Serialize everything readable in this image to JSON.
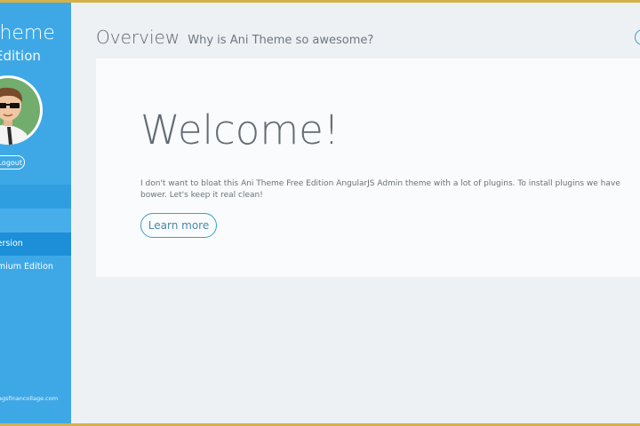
{
  "sidebar": {
    "title": "Theme",
    "subtitle": "Edition",
    "logout_label": "Logout",
    "nav_items": [
      {
        "label": ""
      },
      {
        "label": ""
      },
      {
        "label": "version"
      },
      {
        "label": "emium Edition"
      }
    ],
    "footer": "agsfinancollage.com"
  },
  "header": {
    "title": "Overview",
    "subtitle": "Why is Ani Theme so awesome?"
  },
  "card": {
    "heading": "Welcome!",
    "description": "I don't want to bloat this Ani Theme Free Edition AngularJS Admin theme with a lot of plugins. To install plugins we have bower. Let's keep it real clean!",
    "button_label": "Learn more"
  },
  "colors": {
    "sidebar": "#3ea8e6",
    "accent": "#3a9fcf",
    "frame": "#d4b24a"
  }
}
